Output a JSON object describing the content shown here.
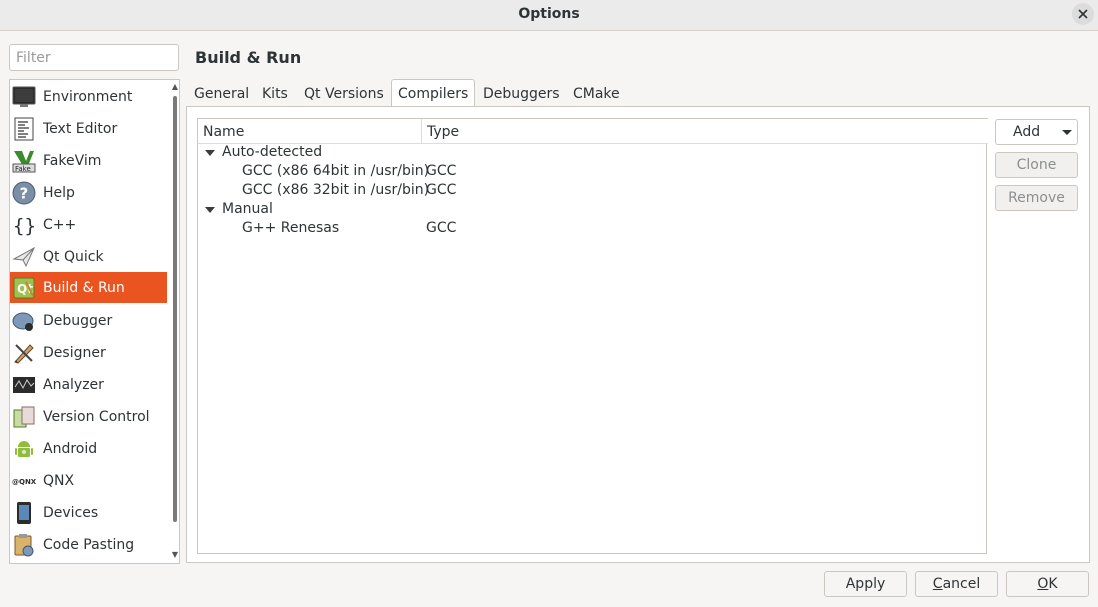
{
  "window": {
    "title": "Options"
  },
  "filter": {
    "placeholder": "Filter",
    "value": ""
  },
  "categories": [
    {
      "label": "Environment",
      "icon": "monitor-icon"
    },
    {
      "label": "Text Editor",
      "icon": "text-document-icon"
    },
    {
      "label": "FakeVim",
      "icon": "fakevim-icon"
    },
    {
      "label": "Help",
      "icon": "help-icon"
    },
    {
      "label": "C++",
      "icon": "braces-icon"
    },
    {
      "label": "Qt Quick",
      "icon": "paper-plane-icon"
    },
    {
      "label": "Build & Run",
      "icon": "qt-build-icon",
      "selected": true
    },
    {
      "label": "Debugger",
      "icon": "bug-icon"
    },
    {
      "label": "Designer",
      "icon": "designer-icon"
    },
    {
      "label": "Analyzer",
      "icon": "analyzer-icon"
    },
    {
      "label": "Version Control",
      "icon": "version-control-icon"
    },
    {
      "label": "Android",
      "icon": "android-icon"
    },
    {
      "label": "QNX",
      "icon": "qnx-icon"
    },
    {
      "label": "Devices",
      "icon": "device-icon"
    },
    {
      "label": "Code Pasting",
      "icon": "code-pasting-icon"
    }
  ],
  "page": {
    "title": "Build & Run"
  },
  "tabs": [
    {
      "label": "General"
    },
    {
      "label": "Kits"
    },
    {
      "label": "Qt Versions"
    },
    {
      "label": "Compilers",
      "active": true
    },
    {
      "label": "Debuggers"
    },
    {
      "label": "CMake"
    }
  ],
  "compilers": {
    "columns": {
      "name": "Name",
      "type": "Type"
    },
    "groups": [
      {
        "label": "Auto-detected",
        "items": [
          {
            "name": "GCC (x86 64bit in /usr/bin)",
            "type": "GCC"
          },
          {
            "name": "GCC (x86 32bit in /usr/bin)",
            "type": "GCC"
          }
        ]
      },
      {
        "label": "Manual",
        "items": [
          {
            "name": "G++ Renesas",
            "type": "GCC"
          }
        ]
      }
    ],
    "buttons": {
      "add": "Add",
      "clone": "Clone",
      "remove": "Remove"
    }
  },
  "footer": {
    "apply": "Apply",
    "cancel_mnemonic": "C",
    "cancel_rest": "ancel",
    "ok_mnemonic": "O",
    "ok_rest": "K"
  },
  "colors": {
    "selection": "#e95420",
    "background": "#f6f5f4"
  }
}
